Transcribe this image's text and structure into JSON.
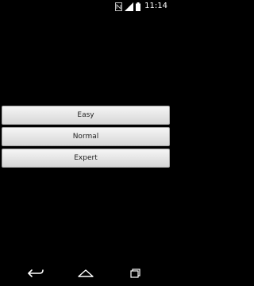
{
  "status_bar": {
    "time": "11:14",
    "icons": [
      "nfc-icon",
      "signal-icon",
      "battery-icon"
    ]
  },
  "menu": {
    "buttons": [
      {
        "label": "Easy"
      },
      {
        "label": "Normal"
      },
      {
        "label": "Expert"
      }
    ]
  },
  "nav_bar": {
    "icons": [
      "back-icon",
      "home-icon",
      "recents-icon"
    ]
  },
  "colors": {
    "background": "#000000",
    "button_top": "#f5f5f5",
    "button_bottom": "#d6d6d6",
    "button_text": "#222222",
    "icon": "#ffffff"
  }
}
